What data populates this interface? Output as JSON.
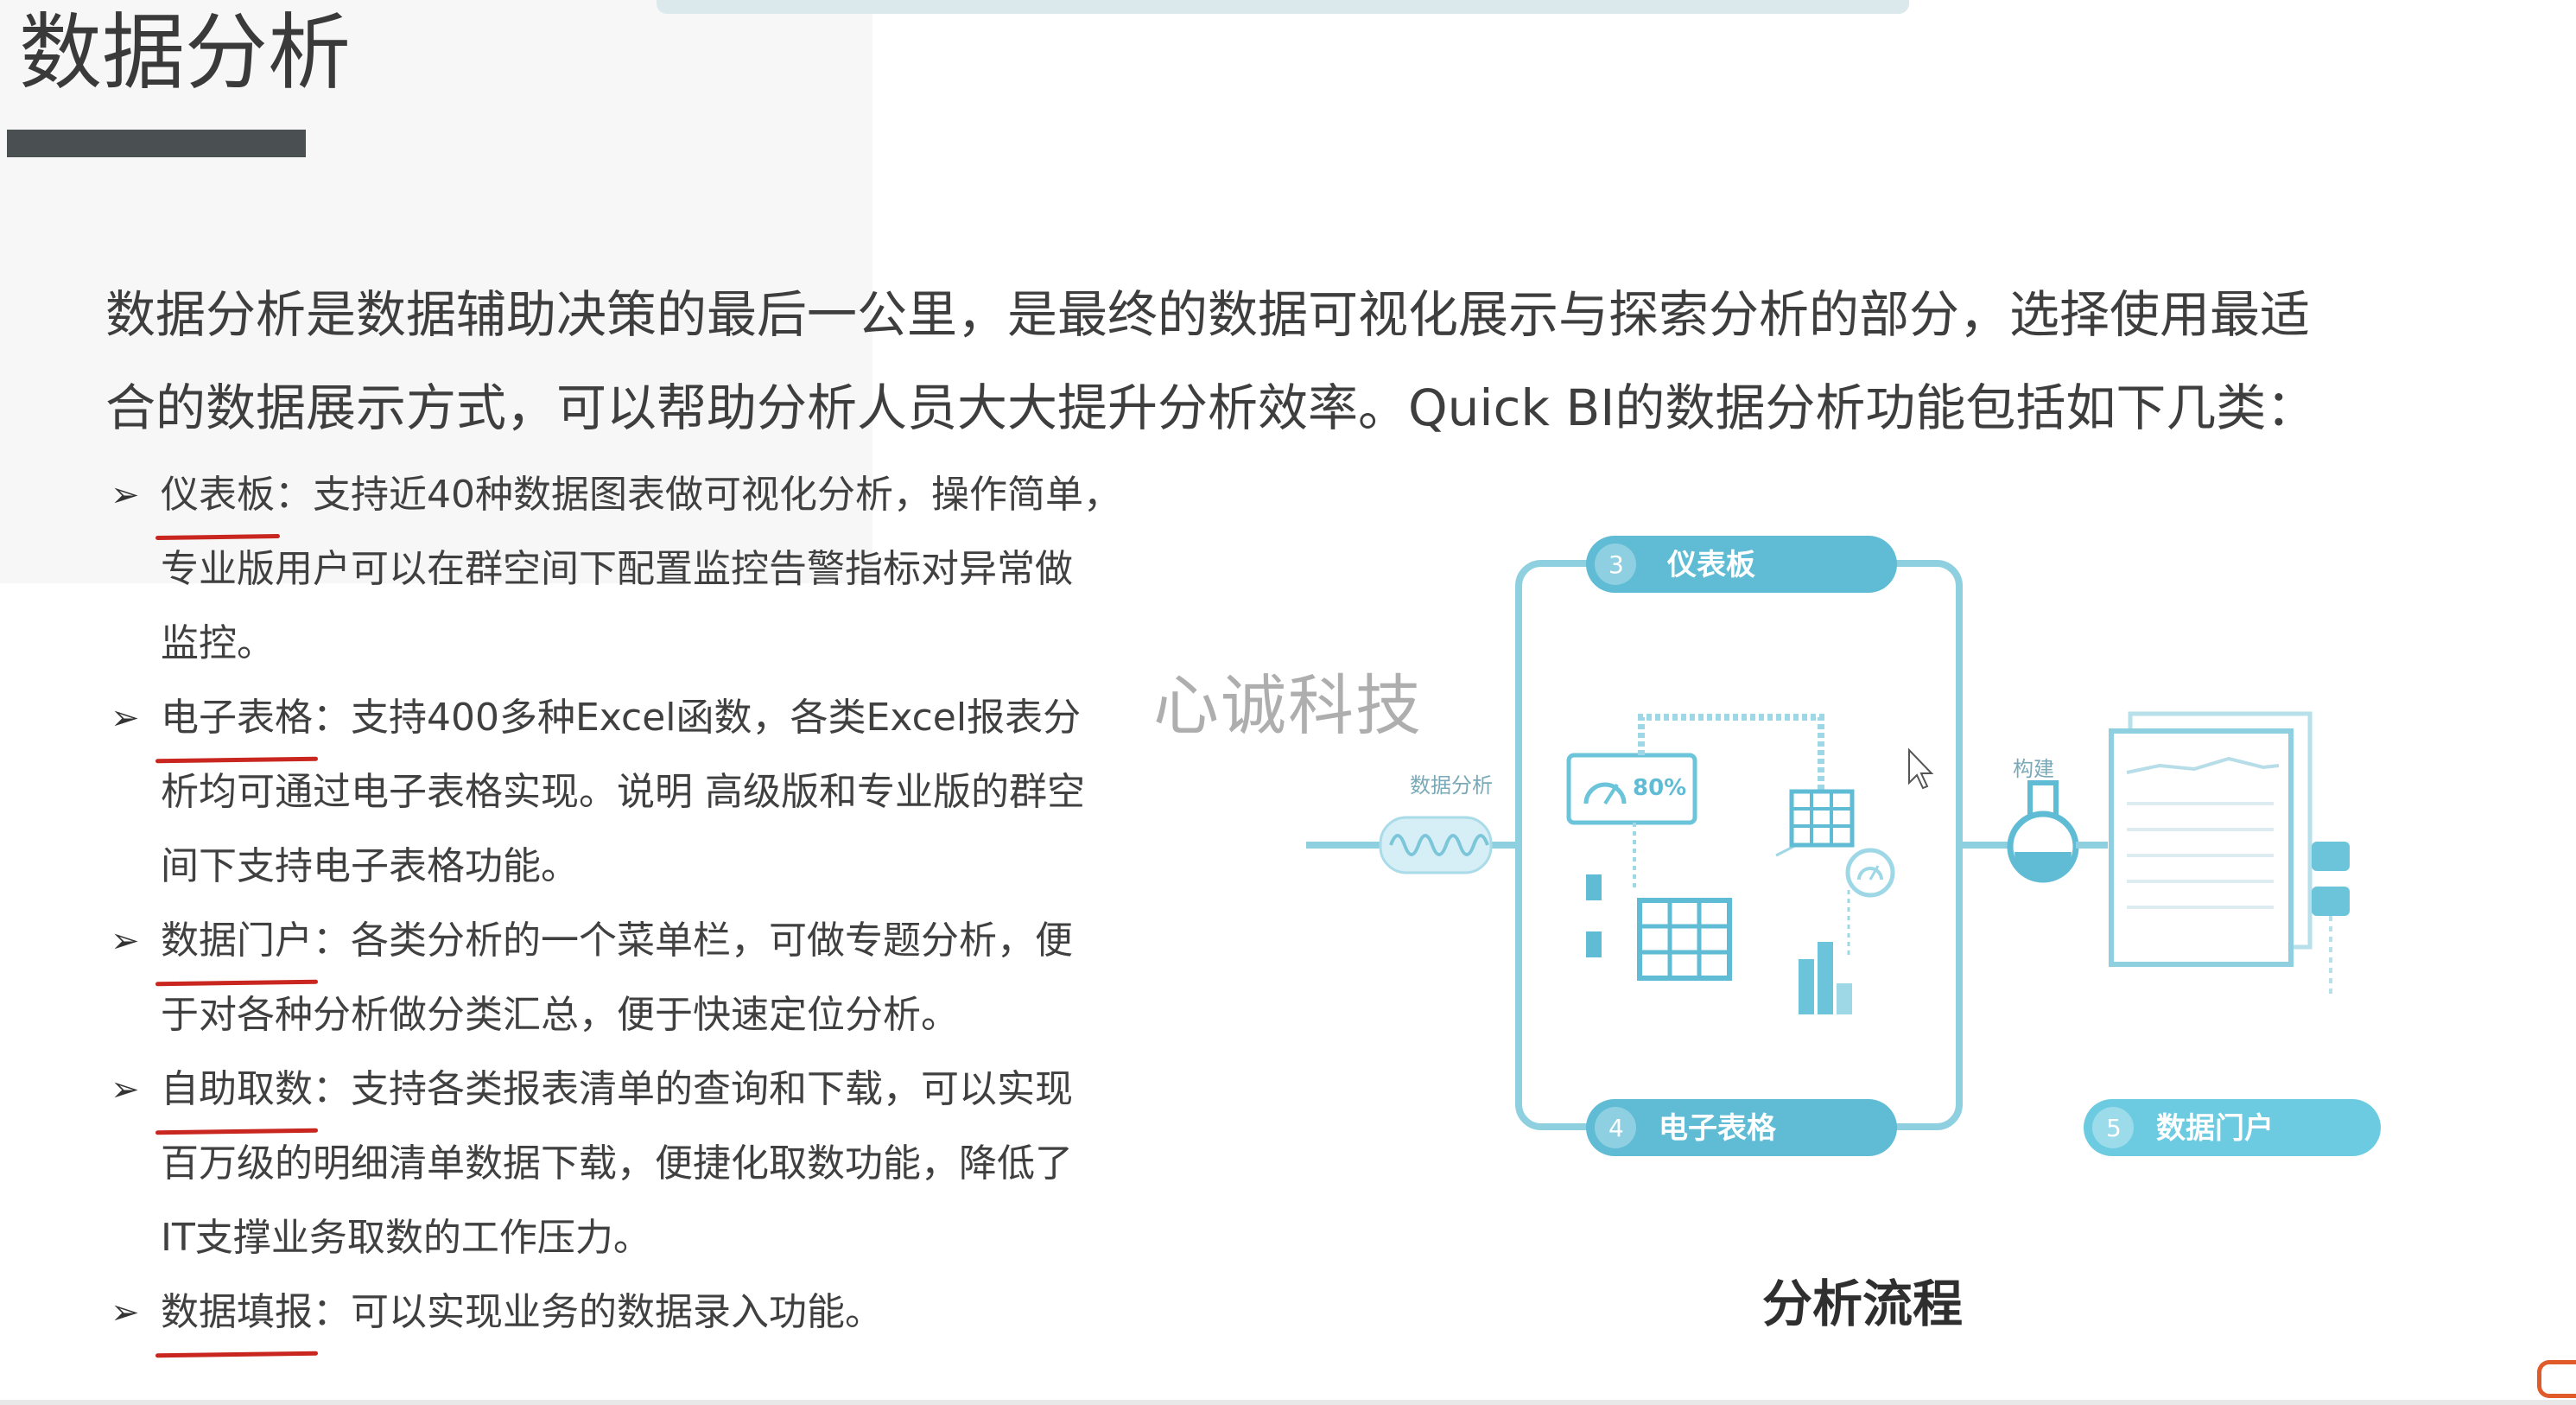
{
  "slide": {
    "title": "数据分析",
    "intro_lines": [
      "数据分析是数据辅助决策的最后一公里，是最终的数据可视化展示与探索分析的部分，选择使用最适",
      "合的数据展示方式，可以帮助分析人员大大提升分析效率。Quick BI的数据分析功能包括如下几类："
    ],
    "watermark": "心诚科技"
  },
  "features": [
    {
      "name": "仪表板",
      "lines": [
        "：支持近40种数据图表做可视化分析，操作简单，",
        "专业版用户可以在群空间下配置监控告警指标对异常做",
        "监控。"
      ]
    },
    {
      "name": "电子表格",
      "lines": [
        "：支持400多种Excel函数，各类Excel报表分",
        "析均可通过电子表格实现。说明 高级版和专业版的群空",
        "间下支持电子表格功能。"
      ]
    },
    {
      "name": "数据门户",
      "lines": [
        "：各类分析的一个菜单栏，可做专题分析，便",
        "于对各种分析做分类汇总，便于快速定位分析。"
      ]
    },
    {
      "name": "自助取数",
      "lines": [
        "：支持各类报表清单的查询和下载，可以实现",
        "百万级的明细清单数据下载，便捷化取数功能，降低了",
        "IT支撑业务取数的工作压力。"
      ]
    },
    {
      "name": "数据填报",
      "lines": [
        "：可以实现业务的数据录入功能。"
      ]
    }
  ],
  "diagram": {
    "caption": "分析流程",
    "input_label": "数据分析",
    "gauge_label": "80%",
    "flask_label": "构建",
    "pills": [
      {
        "num": "3",
        "label": "仪表板"
      },
      {
        "num": "4",
        "label": "电子表格"
      },
      {
        "num": "5",
        "label": "数据门户"
      }
    ],
    "colors": {
      "line": "#8fd0e0",
      "pill": "#6cc4da",
      "pill_dark": "#4fb0c9",
      "icon": "#5fbcd4"
    }
  }
}
